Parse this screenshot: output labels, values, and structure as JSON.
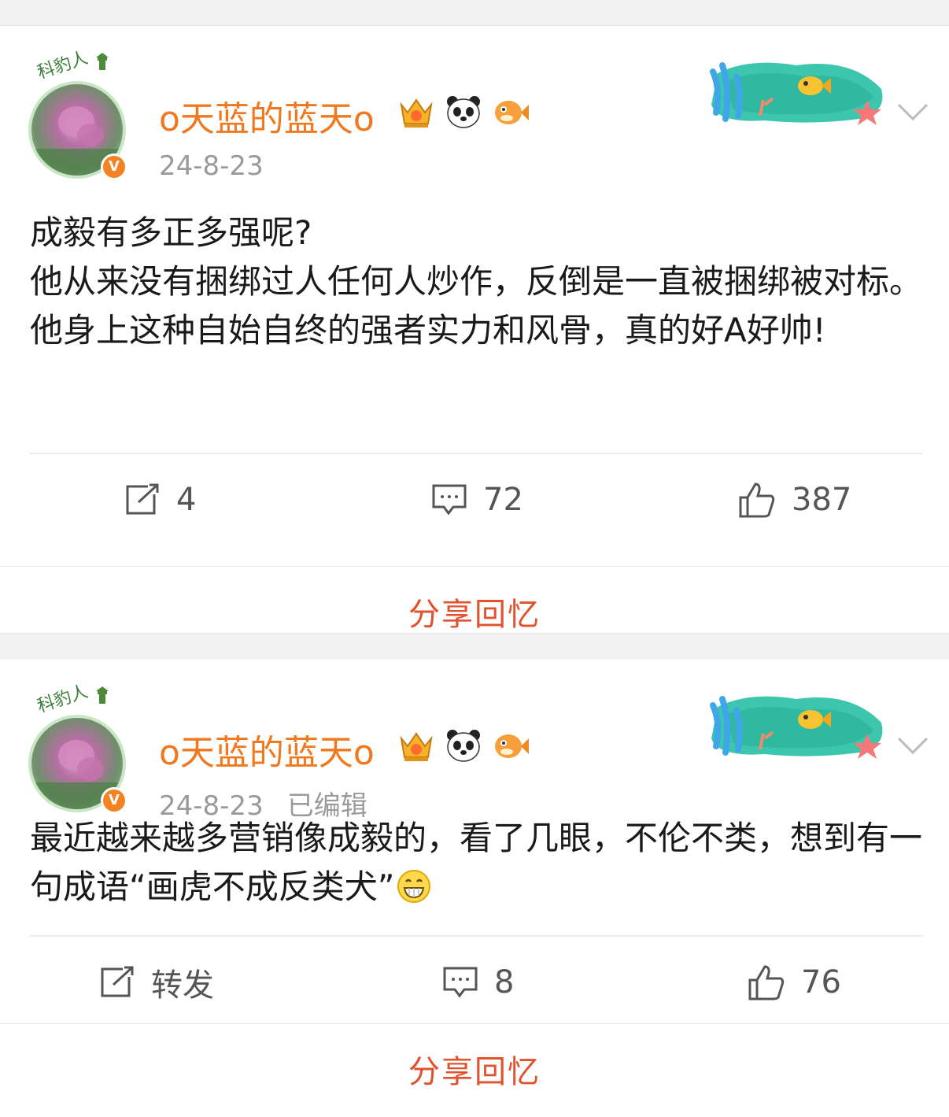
{
  "posts": [
    {
      "username": "o天蓝的蓝天o",
      "avatar_frame_label": "科豹人",
      "verified_badge": "V",
      "date": "24-8-23",
      "edited_label": "",
      "content": "成毅有多正多强呢?\n他从来没有捆绑过人任何人炒作，反倒是一直被捆绑被对标。\n他身上这种自始自终的强者实力和风骨，真的好A好帅!",
      "trailing_emoji": "",
      "actions": {
        "repost": "4",
        "comment": "72",
        "like": "387"
      },
      "share_label": "分享回忆",
      "icons": [
        "crown-badge-icon",
        "panda-icon",
        "pufferfish-icon",
        "ocean-decoration-icon",
        "chevron-down-icon"
      ]
    },
    {
      "username": "o天蓝的蓝天o",
      "avatar_frame_label": "科豹人",
      "verified_badge": "V",
      "date": "24-8-23",
      "edited_label": "已编辑",
      "content": "最近越来越多营销像成毅的，看了几眼，不伦不类，想到有一句成语“画虎不成反类犬”",
      "trailing_emoji": "grin-emoji",
      "actions": {
        "repost": "转发",
        "comment": "8",
        "like": "76"
      },
      "share_label": "分享回忆",
      "icons": [
        "crown-badge-icon",
        "panda-icon",
        "pufferfish-icon",
        "ocean-decoration-icon",
        "chevron-down-icon"
      ]
    }
  ],
  "colors": {
    "username": "#f0781e",
    "share": "#e0532e",
    "meta": "#9a9a9a",
    "verified": "#f58220"
  }
}
